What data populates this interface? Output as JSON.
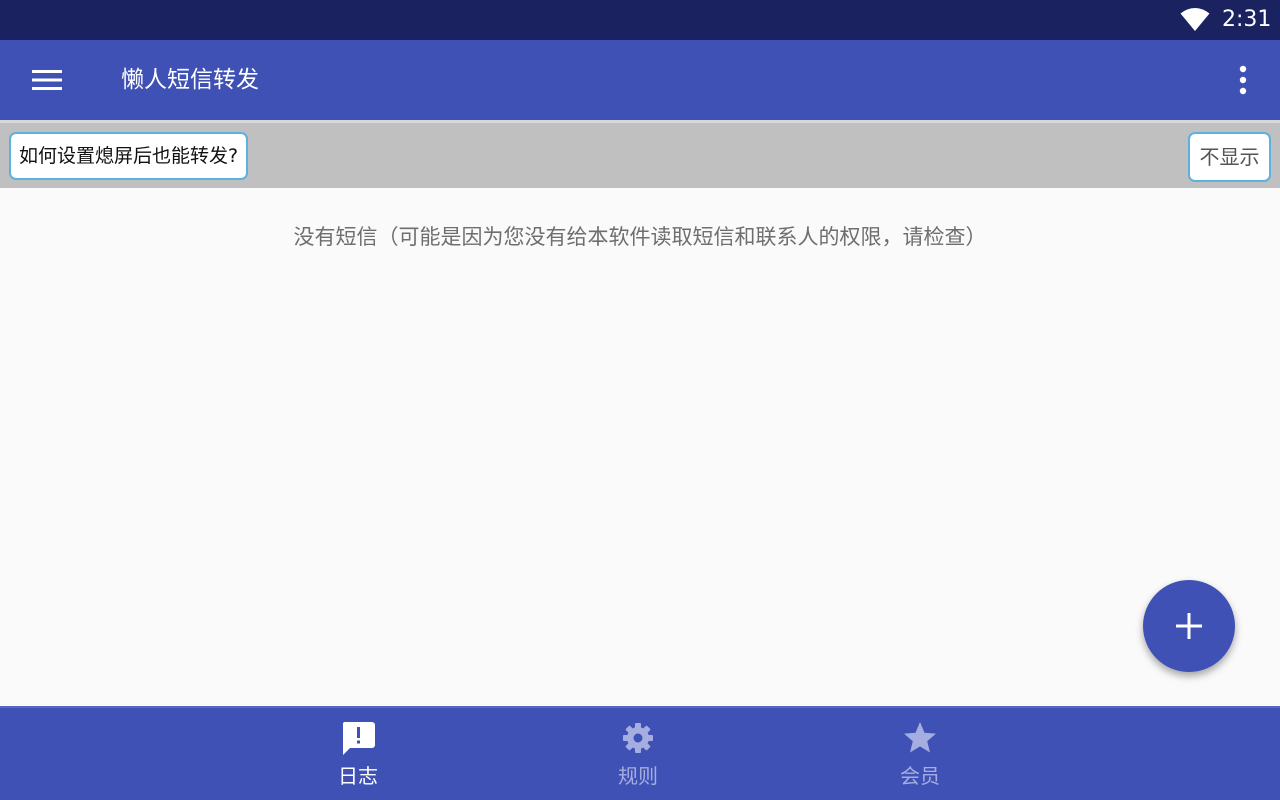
{
  "status_bar": {
    "time": "2:31",
    "wifi_icon": "wifi-icon"
  },
  "app_bar": {
    "title": "懒人短信转发",
    "menu_icon": "menu-icon",
    "overflow_icon": "more-vert-icon"
  },
  "tip": {
    "link_text": "如何设置熄屏后也能转发?",
    "dismiss_label": "不显示"
  },
  "content": {
    "empty_message": "没有短信（可能是因为您没有给本软件读取短信和联系人的权限，请检查）"
  },
  "fab": {
    "icon": "add-icon"
  },
  "bottom_nav": {
    "items": [
      {
        "label": "日志",
        "icon": "feedback-icon",
        "active": true
      },
      {
        "label": "规则",
        "icon": "gear-icon",
        "active": false
      },
      {
        "label": "会员",
        "icon": "star-icon",
        "active": false
      }
    ]
  },
  "colors": {
    "status_bar": "#1a2260",
    "primary": "#3f51b5",
    "tip_bar": "#c0c0c0",
    "tip_border": "#5fb0e2",
    "nav_inactive": "#a4aee0"
  }
}
